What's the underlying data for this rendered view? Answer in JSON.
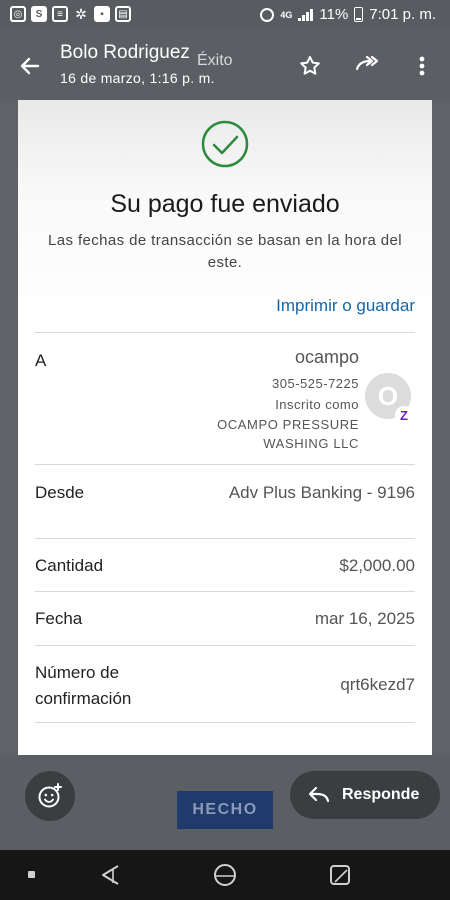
{
  "status_bar": {
    "battery": "11%",
    "time": "7:01 p. m.",
    "left_icons": [
      "cast-icon",
      "instagram-icon",
      "s-app-icon",
      "document-icon",
      "gallery-icon",
      "chat-icon",
      "news-icon"
    ],
    "s_letter": "S",
    "network_badge": "4G"
  },
  "header": {
    "sender": "Bolo Rodriguez",
    "subject": "Éxito",
    "date": "16 de marzo, 1:16 p. m."
  },
  "payment": {
    "title": "Su pago fue enviado",
    "note": "Las fechas de transacción se basan en la hora del este.",
    "print_link": "Imprimir o guardar",
    "to": {
      "label": "A",
      "name": "ocampo",
      "phone": "305-525-7225",
      "enrolled": "Inscrito como",
      "company": "OCAMPO PRESSURE WASHING LLC",
      "avatar_initial": "O",
      "badge": "Z"
    },
    "from": {
      "label": "Desde",
      "value": "Adv Plus Banking - 9196"
    },
    "amount": {
      "label": "Cantidad",
      "value": "$2,000.00"
    },
    "date": {
      "label": "Fecha",
      "value": "mar 16, 2025"
    },
    "confirmation": {
      "label": "Número de confirmación",
      "value": "qrt6kezd7"
    }
  },
  "actions": {
    "done": "HECHO",
    "reply": "Responde"
  },
  "colors": {
    "link": "#1666a8",
    "check": "#2e8b3c",
    "done_button": "#1f3a6b",
    "zelle": "#6d1ed4"
  }
}
